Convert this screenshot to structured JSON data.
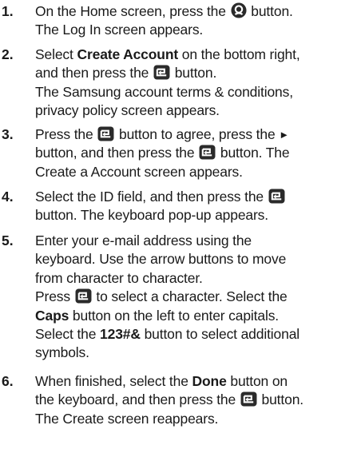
{
  "steps": [
    {
      "number": "1.",
      "line1_a": "On the Home screen, press the",
      "line1_b": "button.",
      "line2": "The Log In screen appears."
    },
    {
      "number": "2.",
      "line1_a": "Select",
      "line1_b": "Create Account",
      "line1_c": "on the bottom right,",
      "line2_a": "and then press the",
      "line2_b": "button.",
      "line3": "The Samsung account terms & conditions,",
      "line4": "privacy policy screen appears."
    },
    {
      "number": "3.",
      "line1_a": "Press the",
      "line1_b": "button to agree, press the",
      "line2_a": "button, and then press the",
      "line2_b": "button. The",
      "line3": "Create a Account screen appears."
    },
    {
      "number": "4.",
      "line1_a": "Select the ID field, and then press the",
      "line2": "button. The keyboard pop-up appears."
    },
    {
      "number": "5.",
      "line1": "Enter your e-mail address using the",
      "line2": "keyboard. Use the arrow buttons to move",
      "line3": "from character to character.",
      "line4_a": "Press",
      "line4_b": "to select a character. Select the",
      "line5_a": "Caps",
      "line5_b": "button on the left to enter capitals.",
      "line6_a": "Select the",
      "line6_b": "123#&",
      "line6_c": "button to select additional",
      "line7": "symbols."
    },
    {
      "number": "6.",
      "line1_a": "When finished, select the",
      "line1_b": "Done",
      "line1_c": "button on",
      "line2_a": "the keyboard, and then press the",
      "line2_b": "button.",
      "line3": "The Create screen reappears."
    }
  ],
  "icons": {
    "account": "account-icon",
    "enter": "enter-icon",
    "right_arrow": "right-arrow-icon",
    "right_arrow_glyph": "►"
  },
  "colors": {
    "text": "#1a1a1a",
    "icon_fill": "#2a2a2a"
  }
}
